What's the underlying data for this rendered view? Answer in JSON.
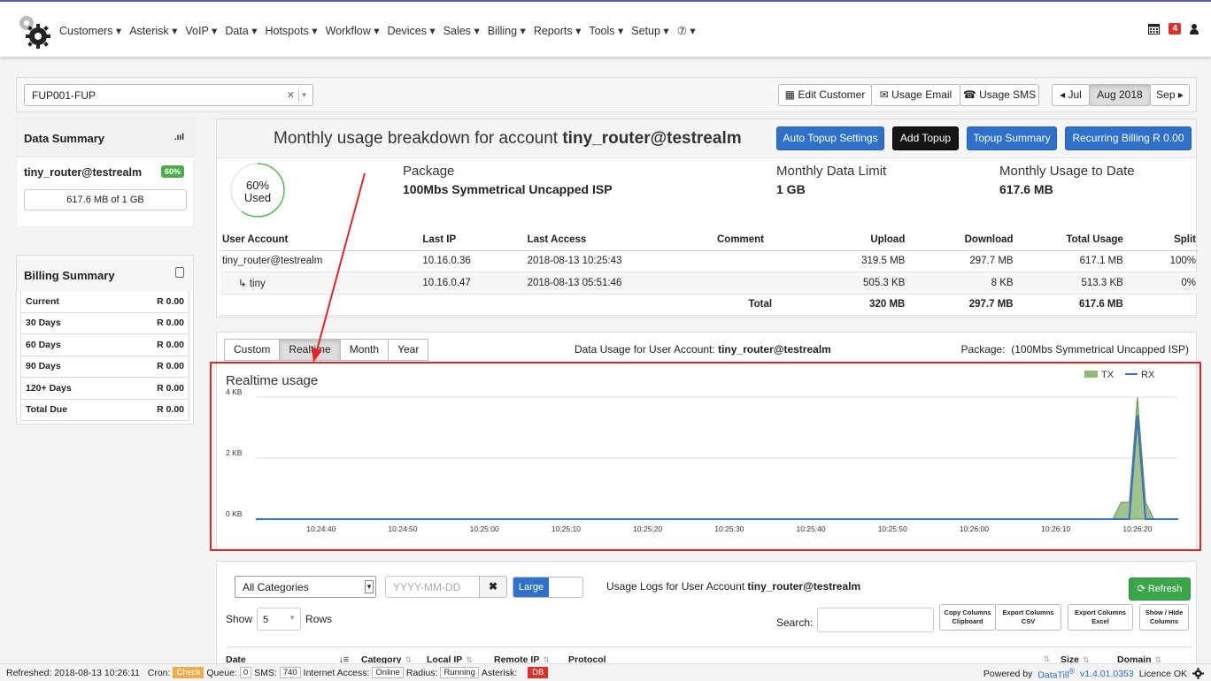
{
  "nav": {
    "menu": [
      "Customers ▾",
      "Asterisk ▾",
      "VoIP ▾",
      "Data ▾",
      "Hotspots ▾",
      "Workflow ▾",
      "Devices ▾",
      "Sales ▾",
      "Billing ▾",
      "Reports ▾",
      "Tools ▾",
      "Setup ▾",
      "⑦ ▾"
    ],
    "notifications": "4"
  },
  "selector": {
    "customer": "FUP001-FUP",
    "edit_customer": "Edit Customer",
    "usage_email": "Usage Email",
    "usage_sms": "Usage SMS",
    "prev_month": "◂ Jul",
    "current_month": "Aug 2018",
    "next_month": "Sep ▸"
  },
  "data_summary": {
    "title": "Data Summary",
    "account": "tiny_router@testrealm",
    "percent": "60%",
    "usage": "617.6 MB of 1 GB"
  },
  "billing_summary": {
    "title": "Billing Summary",
    "rows": [
      {
        "label": "Current",
        "value": "R 0.00"
      },
      {
        "label": "30 Days",
        "value": "R 0.00"
      },
      {
        "label": "60 Days",
        "value": "R 0.00"
      },
      {
        "label": "90 Days",
        "value": "R 0.00"
      },
      {
        "label": "120+ Days",
        "value": "R 0.00"
      },
      {
        "label": "Total Due",
        "value": "R 0.00"
      }
    ]
  },
  "monthly": {
    "title_prefix": "Monthly usage breakdown for account ",
    "title_account": "tiny_router@testrealm",
    "auto_topup": "Auto Topup Settings",
    "add_topup": "Add Topup",
    "topup_summary": "Topup Summary",
    "recurring_billing": "Recurring Billing R 0.00",
    "gauge_percent": "60%",
    "gauge_label": "Used",
    "gauge_fraction": 0.6,
    "package_label": "Package",
    "package_value": "100Mbs Symmetrical Uncapped ISP",
    "limit_label": "Monthly Data Limit",
    "limit_value": "1 GB",
    "todate_label": "Monthly Usage to Date",
    "todate_value": "617.6 MB",
    "columns": [
      "User Account",
      "Last IP",
      "Last Access",
      "Comment",
      "Upload",
      "Download",
      "Total Usage",
      "Split"
    ],
    "rows": [
      {
        "account": "tiny_router@testrealm",
        "ip": "10.16.0.36",
        "access": "2018-08-13 10:25:43",
        "comment": "",
        "upload": "319.5 MB",
        "download": "297.7 MB",
        "total": "617.1 MB",
        "split": "100%"
      },
      {
        "account": "↳ tiny",
        "ip": "10.16.0.47",
        "access": "2018-08-13 05:51:46",
        "comment": "",
        "upload": "505.3 KB",
        "download": "8 KB",
        "total": "513.3 KB",
        "split": "0%"
      }
    ],
    "totals": {
      "label": "Total",
      "upload": "320 MB",
      "download": "297.7 MB",
      "total": "617.6 MB"
    }
  },
  "chart_panel": {
    "tabs": [
      "Custom",
      "Realtime",
      "Month",
      "Year"
    ],
    "active_tab": "Realtime",
    "title_prefix": "Data Usage for User Account: ",
    "title_account": "tiny_router@testrealm",
    "package_prefix": "Package:",
    "package_value": "(100Mbs Symmetrical Uncapped ISP)"
  },
  "chart_data": {
    "type": "area",
    "title": "Realtime usage",
    "x_ticks": [
      "10:24:40",
      "10:24:50",
      "10:25:00",
      "10:25:10",
      "10:25:20",
      "10:25:30",
      "10:25:40",
      "10:25:50",
      "10:26:00",
      "10:26:10",
      "10:26:20"
    ],
    "y_ticks": [
      "0 KB",
      "2 KB",
      "4 KB"
    ],
    "ylim": [
      0,
      4
    ],
    "xlim": [
      "10:24:32",
      "10:26:25"
    ],
    "legend": "top-right",
    "grid": true,
    "series": [
      {
        "name": "TX",
        "color": "#8fb87a",
        "style": "area",
        "x": [
          "10:24:32",
          "10:26:17",
          "10:26:18",
          "10:26:19",
          "10:26:20",
          "10:26:21",
          "10:26:22",
          "10:26:25"
        ],
        "values": [
          0,
          0,
          0.55,
          0.55,
          4.0,
          0.55,
          0,
          0
        ]
      },
      {
        "name": "RX",
        "color": "#3a6fc4",
        "style": "line",
        "x": [
          "10:24:32",
          "10:26:19",
          "10:26:20",
          "10:26:21",
          "10:26:25"
        ],
        "values": [
          0,
          0,
          3.4,
          0,
          0
        ]
      }
    ]
  },
  "logs": {
    "category": "All Categories",
    "date_placeholder": "YYYY-MM-DD",
    "size_toggle": "Large",
    "title_prefix": "Usage Logs for User Account ",
    "title_account": "tiny_router@testrealm",
    "refresh": "Refresh",
    "show_label": "Show",
    "rows_label": "Rows",
    "rows_value": "5",
    "search_label": "Search:",
    "buttons": [
      {
        "line1": "Copy Columns",
        "line2": "Clipboard"
      },
      {
        "line1": "Export Columns",
        "line2": "CSV"
      },
      {
        "line1": "Export Columns",
        "line2": "Excel"
      },
      {
        "line1": "Show / Hide",
        "line2": "Columns"
      }
    ],
    "columns": [
      "Date",
      "Category",
      "Local IP",
      "Remote IP",
      "Protocol",
      "Size",
      "Domain"
    ]
  },
  "footer": {
    "refreshed": "Refreshed: 2018-08-13 10:26:11",
    "cron_label": "Cron:",
    "cron_status": "Check",
    "queue_label": "Queue:",
    "queue_value": "0",
    "sms_label": "SMS:",
    "sms_value": "740",
    "internet_label": "Internet Access:",
    "internet_value": "Online",
    "radius_label": "Radius:",
    "radius_value": "Running",
    "asterisk_label": "Asterisk:",
    "db": "DB",
    "powered": "Powered by",
    "brand": "DataTill",
    "reg": "®",
    "version": "v1.4.01.0353",
    "licence": "Licence OK"
  }
}
